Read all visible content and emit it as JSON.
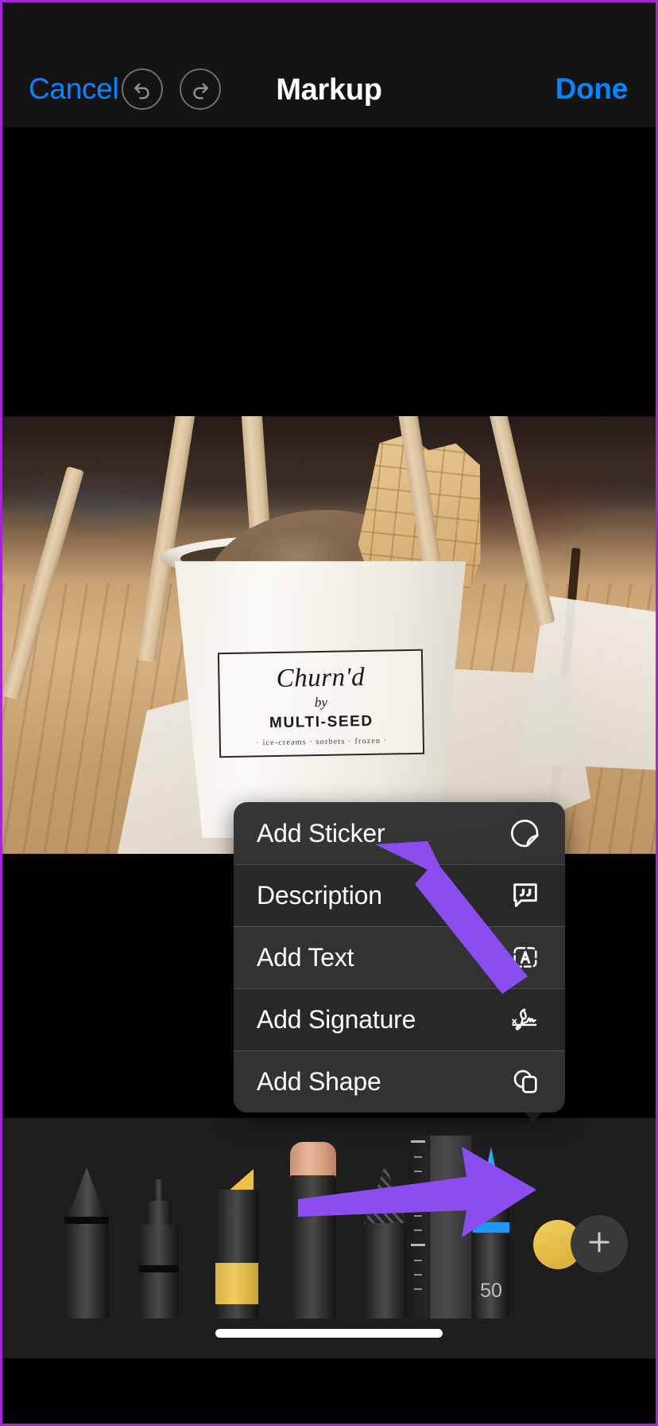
{
  "navbar": {
    "cancel_label": "Cancel",
    "title": "Markup",
    "done_label": "Done",
    "undo_icon": "undo-arrow-icon",
    "redo_icon": "redo-arrow-icon",
    "accent_color": "#0a84ff"
  },
  "photo": {
    "label_brand": "Churn'd",
    "label_by": "by",
    "label_multiseed": "MULTI-SEED",
    "label_sub": "· ice-creams · sorbets · frozen ·"
  },
  "context_menu": {
    "items": [
      {
        "label": "Add Sticker",
        "icon": "sticker-icon"
      },
      {
        "label": "Description",
        "icon": "speech-bubble-quote-icon"
      },
      {
        "label": "Add Text",
        "icon": "text-box-a-icon"
      },
      {
        "label": "Add Signature",
        "icon": "signature-icon"
      },
      {
        "label": "Add Shape",
        "icon": "shapes-icon"
      }
    ]
  },
  "toolbar": {
    "tools": [
      {
        "name": "pen-tool",
        "color": "#3a3a3a"
      },
      {
        "name": "marker-tool",
        "color": "#3a3a3a"
      },
      {
        "name": "highlighter-tool",
        "color": "#e8c34a"
      },
      {
        "name": "eraser-tool",
        "color": "#e0a98c"
      },
      {
        "name": "pencil-tool",
        "color": "#3a3a3a"
      },
      {
        "name": "ruler-tool",
        "color": "#4a4a4a"
      },
      {
        "name": "ink-pen-tool",
        "color": "#2196f3"
      }
    ],
    "opacity_value": "50",
    "color_swatch": "#e8c34a",
    "add_button_icon": "plus-icon"
  },
  "annotations": {
    "arrow_color": "#8b4df0",
    "arrow_to_menu": "arrow-pointing-to-add-sticker",
    "arrow_to_plus": "arrow-pointing-to-plus-button"
  },
  "home_indicator": "home-indicator-bar"
}
